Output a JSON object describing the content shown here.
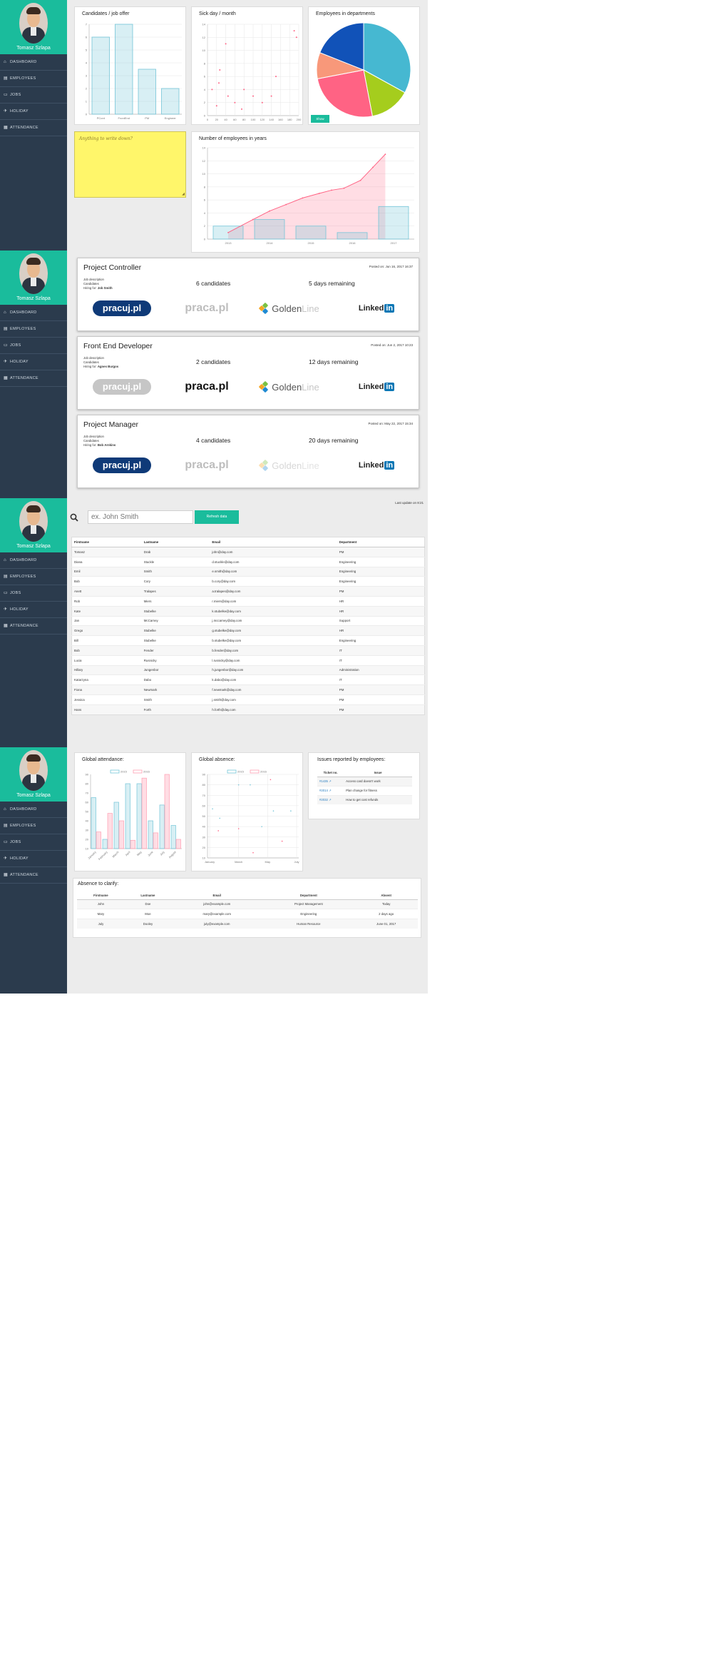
{
  "profile": {
    "name": "Tomasz Szlapa"
  },
  "nav": [
    "DASHBOARD",
    "EMPLOYEES",
    "JOBS",
    "HOLIDAY",
    "ATTENDANCE"
  ],
  "dashboard": {
    "candidates_title": "Candidates / job offer",
    "sick_title": "Sick day / month",
    "departments_title": "Employees in departments",
    "departments_button": "Show",
    "sticky_note": "Anything to write down?",
    "employees_years_title": "Number of employees in years"
  },
  "jobs": [
    {
      "title": "Project Controller",
      "posted": "Posted on: Jun 16, 2017 16:37",
      "desc": "Job description",
      "cand_label": "Candidates",
      "hiring_label": "Hiring for:",
      "hiring_for": "Job Smith",
      "candidates": "6 candidates",
      "remaining": "5 days remaining"
    },
    {
      "title": "Front End Developer",
      "posted": "Posted on: Jun 2, 2017 10:23",
      "desc": "Job description",
      "cand_label": "Candidates",
      "hiring_label": "Hiring for:",
      "hiring_for": "Agnes Burgos",
      "candidates": "2 candidates",
      "remaining": "12 days remaining"
    },
    {
      "title": "Project Manager",
      "posted": "Posted on: May 22, 2017 15:34",
      "desc": "Job description",
      "cand_label": "Candidates",
      "hiring_label": "Hiring for:",
      "hiring_for": "Bob Arnkins",
      "candidates": "4 candidates",
      "remaining": "20 days remaining"
    }
  ],
  "portals": {
    "pracuj": "pracuj.pl",
    "praca": "praca.pl",
    "golden_a": "Golden",
    "golden_b": "Line",
    "linked_a": "Linked",
    "linked_b": "in",
    "states": [
      {
        "pracuj": true,
        "praca": false,
        "golden": true,
        "linked": true
      },
      {
        "pracuj": false,
        "praca": true,
        "golden": true,
        "linked": true
      },
      {
        "pracuj": true,
        "praca": false,
        "golden": false,
        "linked": true
      }
    ]
  },
  "employees": {
    "last_update": "Last update on 8:21",
    "search_placeholder": "ex. John Smith",
    "search_button": "Refresh data",
    "columns": [
      "Firstname",
      "Lastname",
      "Email",
      "Department"
    ],
    "rows": [
      [
        "Tomasz",
        "Drab",
        "john@day.com",
        "PM"
      ],
      [
        "Diana",
        "Stuckle",
        "d.stuckle@day.com",
        "Engineering"
      ],
      [
        "Emil",
        "Smith",
        "e.smith@day.com",
        "Engineering"
      ],
      [
        "Bob",
        "Cory",
        "b.cory@day.com",
        "Engineering"
      ],
      [
        "Anett",
        "Tralapes",
        "a.tralapes@day.com",
        "PM"
      ],
      [
        "Rob",
        "Miers",
        "r.miers@day.com",
        "HR"
      ],
      [
        "Kate",
        "Stubelke",
        "k.stubelke@day.com",
        "HR"
      ],
      [
        "Jan",
        "McCarney",
        "j.mccarney@day.com",
        "Support"
      ],
      [
        "Grego",
        "Stubelke",
        "g.stubelke@day.com",
        "HR"
      ],
      [
        "Bill",
        "Stubelke",
        "b.stubelke@day.com",
        "Engineering"
      ],
      [
        "Bob",
        "Fender",
        "b.fender@day.com",
        "IT"
      ],
      [
        "Lucia",
        "Rusnicky",
        "l.rusnicky@day.com",
        "IT"
      ],
      [
        "Hillary",
        "Jungenbor",
        "h.jungenbor@day.com",
        "Administration"
      ],
      [
        "Katarzyna",
        "Dabo",
        "k.dabo@day.com",
        "IT"
      ],
      [
        "Fiona",
        "Newmark",
        "f.newmark@day.com",
        "PM"
      ],
      [
        "Jessica",
        "Smith",
        "j.smith@day.com",
        "PM"
      ],
      [
        "Hans",
        "Forth",
        "h.forth@day.com",
        "PM"
      ]
    ]
  },
  "attendance": {
    "global_attendance_title": "Global attendance:",
    "global_absence_title": "Global absence:",
    "issues_title": "Issues reported by employees:",
    "issues_columns": [
      "Ticket no.",
      "Issue"
    ],
    "issues": [
      [
        "#1435 ↗",
        "Access card doesn't work"
      ],
      [
        "#2014 ↗",
        "Plan change for fitness"
      ],
      [
        "#2032 ↗",
        "How to get cost refunds"
      ]
    ],
    "absence_title": "Absence to clarify:",
    "absence_columns": [
      "Firstname",
      "Lastname",
      "Email",
      "Department",
      "Absent"
    ],
    "absence_rows": [
      [
        "John",
        "Doe",
        "john@example.com",
        "Project Management",
        "Today"
      ],
      [
        "Mary",
        "Moe",
        "mary@example.com",
        "Engineering",
        "2 days ago"
      ],
      [
        "July",
        "Dooley",
        "july@example.com",
        "Human Resource",
        "June 01, 2017"
      ]
    ]
  },
  "chart_data": [
    {
      "type": "bar",
      "title": "Candidates / job offer",
      "categories": [
        "PCont",
        "FrontEnd",
        "PM",
        "Engineer"
      ],
      "values": [
        6,
        7,
        3.5,
        2
      ],
      "ylim": [
        0,
        7
      ],
      "yticks": [
        0,
        1,
        2,
        3,
        4,
        5,
        6,
        7
      ],
      "color": "#74c5d8"
    },
    {
      "type": "scatter",
      "title": "Sick day / month",
      "xticks": [
        "0",
        "20",
        "40",
        "60",
        "80",
        "100",
        "120",
        "140",
        "160",
        "180",
        "200"
      ],
      "ylim": [
        0,
        14
      ],
      "yticks": [
        0,
        2,
        4,
        6,
        8,
        10,
        12,
        14
      ],
      "points": [
        [
          10,
          4
        ],
        [
          20,
          1.5
        ],
        [
          25,
          5
        ],
        [
          27,
          7
        ],
        [
          40,
          11
        ],
        [
          45,
          3
        ],
        [
          60,
          2
        ],
        [
          75,
          1
        ],
        [
          80,
          4
        ],
        [
          100,
          3
        ],
        [
          120,
          2
        ],
        [
          140,
          3
        ],
        [
          150,
          6
        ],
        [
          190,
          13
        ],
        [
          195,
          12
        ]
      ]
    },
    {
      "type": "pie",
      "title": "Employees in departments",
      "colors": [
        "#46b8d1",
        "#a5cd1d",
        "#ff6384",
        "#f8987a",
        "#1152b8"
      ],
      "values": [
        33,
        14,
        25,
        9,
        19
      ]
    },
    {
      "type": "bar+line",
      "title": "Number of employees in years",
      "categories": [
        "2013",
        "2014",
        "2015",
        "2016",
        "2017"
      ],
      "bars": [
        2,
        3,
        2,
        1,
        5
      ],
      "line_x": [
        0.5,
        1.1,
        1.5,
        1.9,
        2.3,
        2.7,
        3.0,
        3.3,
        3.7,
        4.0,
        4.3
      ],
      "line": [
        1,
        3,
        4.3,
        5.3,
        6.3,
        7,
        7.5,
        7.8,
        9,
        11,
        13
      ],
      "ylim": [
        0,
        14
      ],
      "yticks": [
        0,
        2,
        4,
        6,
        8,
        10,
        12,
        14
      ]
    },
    {
      "type": "bar",
      "title": "Global attendance:",
      "legend": [
        "2015",
        "2016"
      ],
      "categories": [
        "January",
        "February",
        "March",
        "April",
        "May",
        "June",
        "July",
        "August"
      ],
      "series": [
        {
          "name": "2015",
          "values": [
            65,
            20,
            60,
            80,
            80,
            40,
            57,
            35
          ]
        },
        {
          "name": "2016",
          "values": [
            28,
            48,
            40,
            19,
            86,
            27,
            90,
            20
          ]
        }
      ],
      "ylim": [
        10,
        90
      ],
      "yticks": [
        10,
        20,
        30,
        40,
        50,
        60,
        70,
        80,
        90
      ],
      "colors": [
        "#74c5d8",
        "#ff9fb3"
      ]
    },
    {
      "type": "scatter",
      "title": "Global absence:",
      "legend": [
        "2015",
        "2016"
      ],
      "xticks": [
        "January",
        "March",
        "May",
        "July"
      ],
      "ylim": [
        10,
        90
      ],
      "yticks": [
        10,
        20,
        30,
        40,
        50,
        60,
        70,
        80,
        90
      ],
      "series": [
        {
          "name": "2015",
          "points": [
            [
              0.1,
              57
            ],
            [
              0.35,
              48
            ],
            [
              1,
              80
            ],
            [
              1.4,
              80
            ],
            [
              1.8,
              40
            ],
            [
              2.2,
              55
            ],
            [
              2.8,
              55
            ]
          ]
        },
        {
          "name": "2016",
          "points": [
            [
              0.3,
              36
            ],
            [
              1.0,
              38
            ],
            [
              1.5,
              15
            ],
            [
              2.1,
              85
            ],
            [
              2.5,
              26
            ]
          ]
        }
      ]
    }
  ]
}
